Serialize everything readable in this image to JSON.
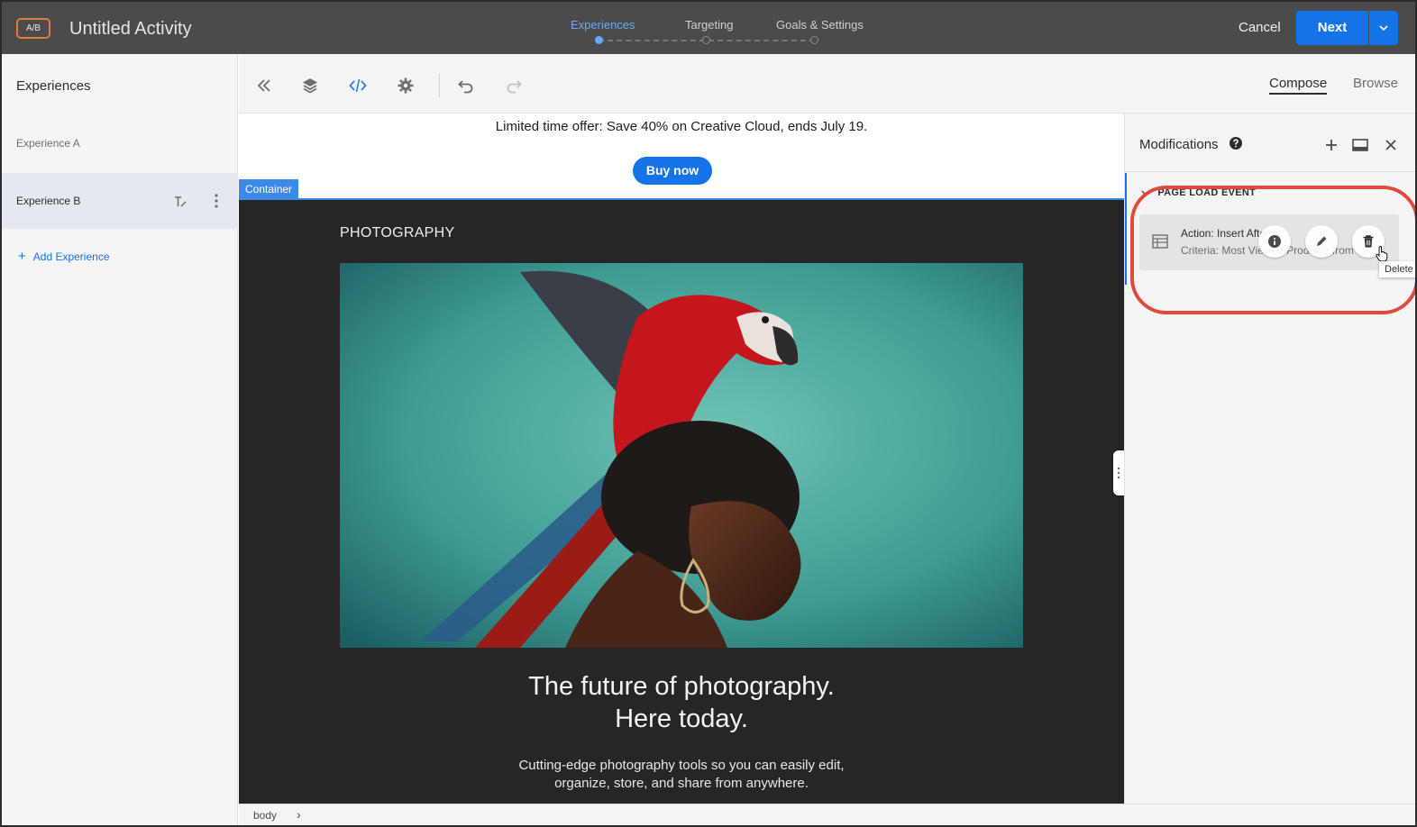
{
  "header": {
    "badge": "A/B",
    "title": "Untitled Activity",
    "steps": [
      {
        "label": "Experiences",
        "active": true
      },
      {
        "label": "Targeting",
        "active": false
      },
      {
        "label": "Goals & Settings",
        "active": false
      }
    ],
    "cancel_label": "Cancel",
    "next_label": "Next"
  },
  "sidebar": {
    "title": "Experiences",
    "items": [
      {
        "label": "Experience A",
        "selected": false
      },
      {
        "label": "Experience B",
        "selected": true
      }
    ],
    "add_label": "Add Experience"
  },
  "toolbar": {
    "icons": [
      "collapse-icon",
      "layers-icon",
      "code-icon",
      "settings-icon",
      "undo-icon",
      "redo-icon"
    ],
    "tabs": [
      {
        "label": "Compose",
        "active": true
      },
      {
        "label": "Browse",
        "active": false
      }
    ]
  },
  "canvas": {
    "offer_text": "Limited time offer: Save 40% on Creative Cloud, ends July 19.",
    "buy_label": "Buy now",
    "container_tag": "Container",
    "section_label": "PHOTOGRAPHY",
    "hero_title_line1": "The future of photography.",
    "hero_title_line2": "Here today.",
    "hero_sub_line1": "Cutting-edge photography tools so you can easily edit,",
    "hero_sub_line2": "organize, store, and share from anywhere."
  },
  "statusbar": {
    "breadcrumb": "body",
    "arrow": "›"
  },
  "modifications": {
    "title": "Modifications",
    "section": "PAGE LOAD EVENT",
    "card": {
      "action": "Action: Insert After",
      "criteria": "Criteria: Most Viewed Products from ..."
    },
    "tooltip": "Delete"
  },
  "colors": {
    "accent": "#1473e6",
    "topbar": "#4b4b4b",
    "highlight": "#e04a3c",
    "badge_border": "#e07b39"
  }
}
